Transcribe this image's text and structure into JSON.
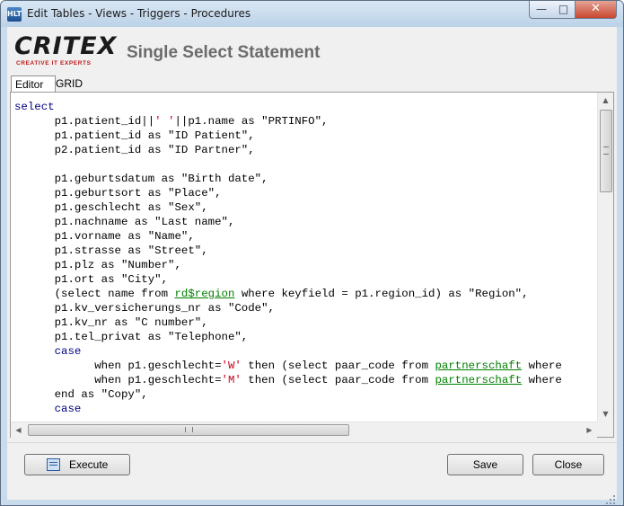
{
  "window": {
    "title": "Edit Tables - Views - Triggers - Procedures",
    "app_icon_text": "HLT",
    "controls": {
      "minimize": "minimize-icon",
      "maximize": "maximize-icon",
      "close": "close-icon"
    }
  },
  "header": {
    "logo_text": "CRITEX",
    "logo_tagline": "CREATIVE IT EXPERTS",
    "title": "Single Select Statement"
  },
  "tabs": [
    {
      "label": "Editor",
      "active": true
    },
    {
      "label": "GRID",
      "active": false
    }
  ],
  "editor": {
    "lines": [
      [
        {
          "t": "select",
          "c": "kw"
        }
      ],
      [
        {
          "t": "      p1.patient_id||"
        },
        {
          "t": "' '",
          "c": "str"
        },
        {
          "t": "||p1.name as \"PRTINFO\","
        }
      ],
      [
        {
          "t": "      p1.patient_id as \"ID Patient\","
        }
      ],
      [
        {
          "t": "      p2.patient_id as \"ID Partner\","
        }
      ],
      [
        {
          "t": ""
        }
      ],
      [
        {
          "t": "      p1.geburtsdatum as \"Birth date\","
        }
      ],
      [
        {
          "t": "      p1.geburtsort as \"Place\","
        }
      ],
      [
        {
          "t": "      p1.geschlecht as \"Sex\","
        }
      ],
      [
        {
          "t": "      p1.nachname as \"Last name\","
        }
      ],
      [
        {
          "t": "      p1.vorname as \"Name\","
        }
      ],
      [
        {
          "t": "      p1.strasse as \"Street\","
        }
      ],
      [
        {
          "t": "      p1.plz as \"Number\","
        }
      ],
      [
        {
          "t": "      p1.ort as \"City\","
        }
      ],
      [
        {
          "t": "      (select name from "
        },
        {
          "t": "rd$region",
          "c": "lnk"
        },
        {
          "t": " where keyfield = p1.region_id) as \"Region\","
        }
      ],
      [
        {
          "t": "      p1.kv_versicherungs_nr as \"Code\","
        }
      ],
      [
        {
          "t": "      p1.kv_nr as \"C number\","
        }
      ],
      [
        {
          "t": "      p1.tel_privat as \"Telephone\","
        }
      ],
      [
        {
          "t": "      case",
          "c": "kw"
        }
      ],
      [
        {
          "t": "            when p1.geschlecht="
        },
        {
          "t": "'W'",
          "c": "str"
        },
        {
          "t": " then (select paar_code from "
        },
        {
          "t": "partnerschaft",
          "c": "lnk"
        },
        {
          "t": " where"
        }
      ],
      [
        {
          "t": "            when p1.geschlecht="
        },
        {
          "t": "'M'",
          "c": "str"
        },
        {
          "t": " then (select paar_code from "
        },
        {
          "t": "partnerschaft",
          "c": "lnk"
        },
        {
          "t": " where"
        }
      ],
      [
        {
          "t": "      end as \"Copy\","
        }
      ],
      [
        {
          "t": "      case",
          "c": "kw"
        }
      ]
    ]
  },
  "scrollbars": {
    "vertical": {
      "up": "arrow-up-icon",
      "down": "arrow-down-icon"
    },
    "horizontal": {
      "left": "arrow-left-icon",
      "right": "arrow-right-icon"
    }
  },
  "footer": {
    "execute_label": "Execute",
    "execute_icon": "execute-icon",
    "save_label": "Save",
    "close_label": "Close"
  }
}
